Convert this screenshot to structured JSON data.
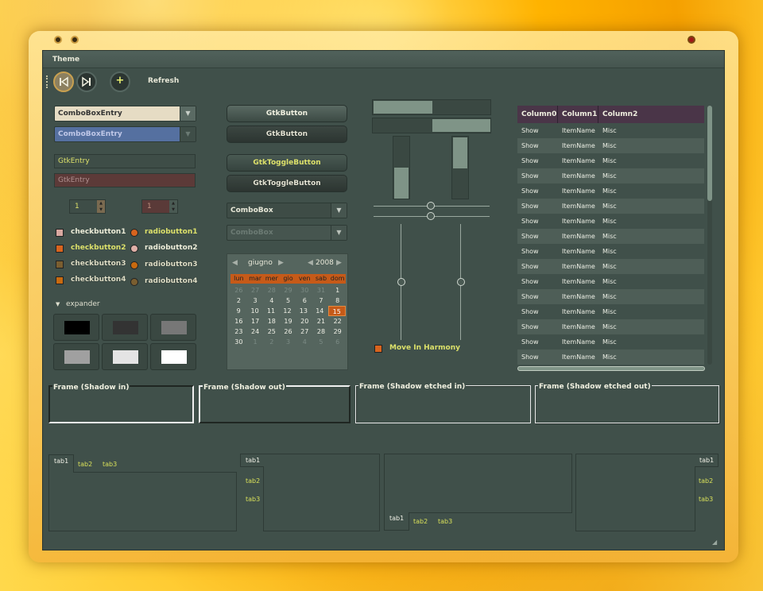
{
  "window": {
    "title": "Theme"
  },
  "toolbar": {
    "refresh_label": "Refresh",
    "add_icon": "+"
  },
  "left": {
    "combo1": "ComboBoxEntry",
    "combo2": "ComboBoxEntry",
    "entry1": "GtkEntry",
    "entry2": "GtkEntry",
    "spin1": "1",
    "spin2": "1",
    "checks": [
      "checkbutton1",
      "checkbutton2",
      "checkbutton3",
      "checkbutton4"
    ],
    "radios": [
      "radiobutton1",
      "radiobutton2",
      "radiobutton3",
      "radiobutton4"
    ],
    "expander": "expander"
  },
  "middle": {
    "button1": "GtkButton",
    "button2": "GtkButton",
    "toggle1": "GtkToggleButton",
    "toggle2": "GtkToggleButton",
    "combo1": "ComboBox",
    "combo2": "ComboBox"
  },
  "calendar": {
    "month": "giugno",
    "year": "2008",
    "weekdays": [
      "lun",
      "mar",
      "mer",
      "gio",
      "ven",
      "sab",
      "dom"
    ],
    "rows": [
      [
        "26",
        "27",
        "28",
        "29",
        "30",
        "31",
        "1"
      ],
      [
        "2",
        "3",
        "4",
        "5",
        "6",
        "7",
        "8"
      ],
      [
        "9",
        "10",
        "11",
        "12",
        "13",
        "14",
        "15"
      ],
      [
        "16",
        "17",
        "18",
        "19",
        "20",
        "21",
        "22"
      ],
      [
        "23",
        "24",
        "25",
        "26",
        "27",
        "28",
        "29"
      ],
      [
        "30",
        "1",
        "2",
        "3",
        "4",
        "5",
        "6"
      ]
    ],
    "selected": "15"
  },
  "sliders": {
    "harmony_label": "Move In Harmony"
  },
  "tree": {
    "columns": [
      "Column0",
      "Column1",
      "Column2"
    ],
    "row": [
      "Show",
      "ItemName",
      "Misc"
    ],
    "row_count": 16
  },
  "frames": [
    "Frame (Shadow in)",
    "Frame (Shadow out)",
    "Frame (Shadow etched in)",
    "Frame (Shadow etched out)"
  ],
  "notebooks": {
    "tabs": [
      "tab1",
      "tab2",
      "tab3"
    ]
  },
  "colors": {
    "accent": "#c65a18",
    "text_yellow": "#d8e05a",
    "panel": "#40504a"
  }
}
